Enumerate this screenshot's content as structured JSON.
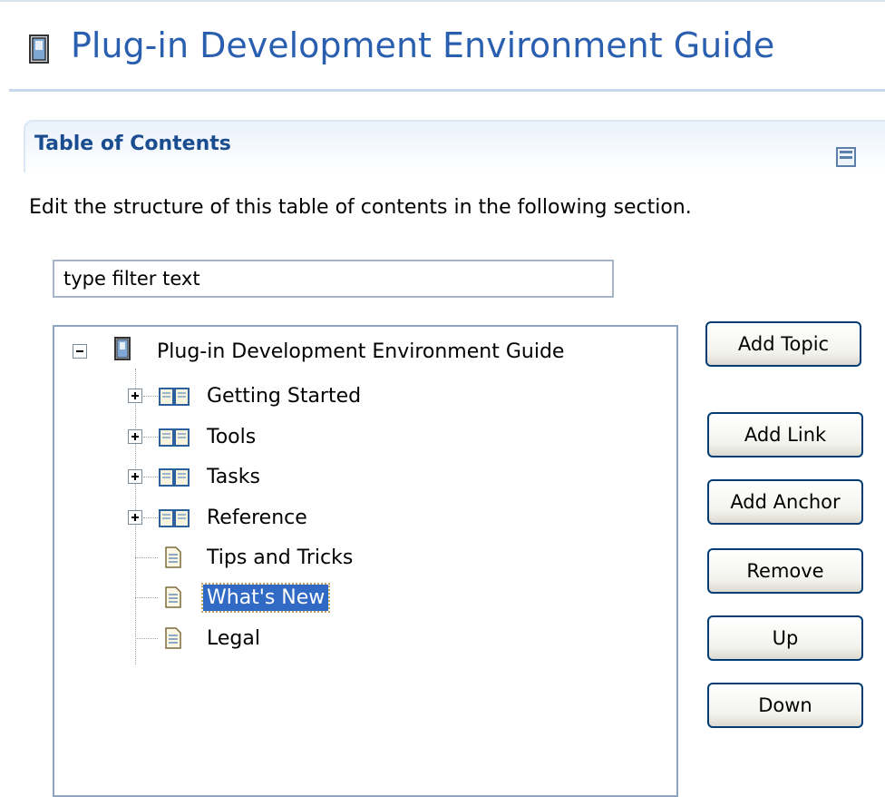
{
  "header": {
    "title": "Plug-in Development Environment Guide",
    "icon": "guide-book-icon"
  },
  "section": {
    "title": "Table of Contents",
    "description": "Edit the structure of this table of contents in the following section.",
    "collapse_icon": "collapse-icon"
  },
  "filter": {
    "placeholder": "type filter text"
  },
  "tree": {
    "root": {
      "label": "Plug-in Development Environment Guide",
      "icon": "guide-book-icon",
      "expanded": true
    },
    "items": [
      {
        "label": "Getting Started",
        "icon": "open-book-icon",
        "expandable": true
      },
      {
        "label": "Tools",
        "icon": "open-book-icon",
        "expandable": true
      },
      {
        "label": "Tasks",
        "icon": "open-book-icon",
        "expandable": true
      },
      {
        "label": "Reference",
        "icon": "open-book-icon",
        "expandable": true
      },
      {
        "label": "Tips and Tricks",
        "icon": "page-icon",
        "expandable": false
      },
      {
        "label": "What's New",
        "icon": "page-icon",
        "expandable": false,
        "selected": true
      },
      {
        "label": "Legal",
        "icon": "page-icon",
        "expandable": false
      }
    ]
  },
  "buttons": {
    "add_topic": "Add Topic",
    "add_link": "Add Link",
    "add_anchor": "Add Anchor",
    "remove": "Remove",
    "up": "Up",
    "down": "Down"
  },
  "colors": {
    "title": "#2a5fb0",
    "section_title": "#1a4d8f",
    "selection": "#316ac5"
  }
}
